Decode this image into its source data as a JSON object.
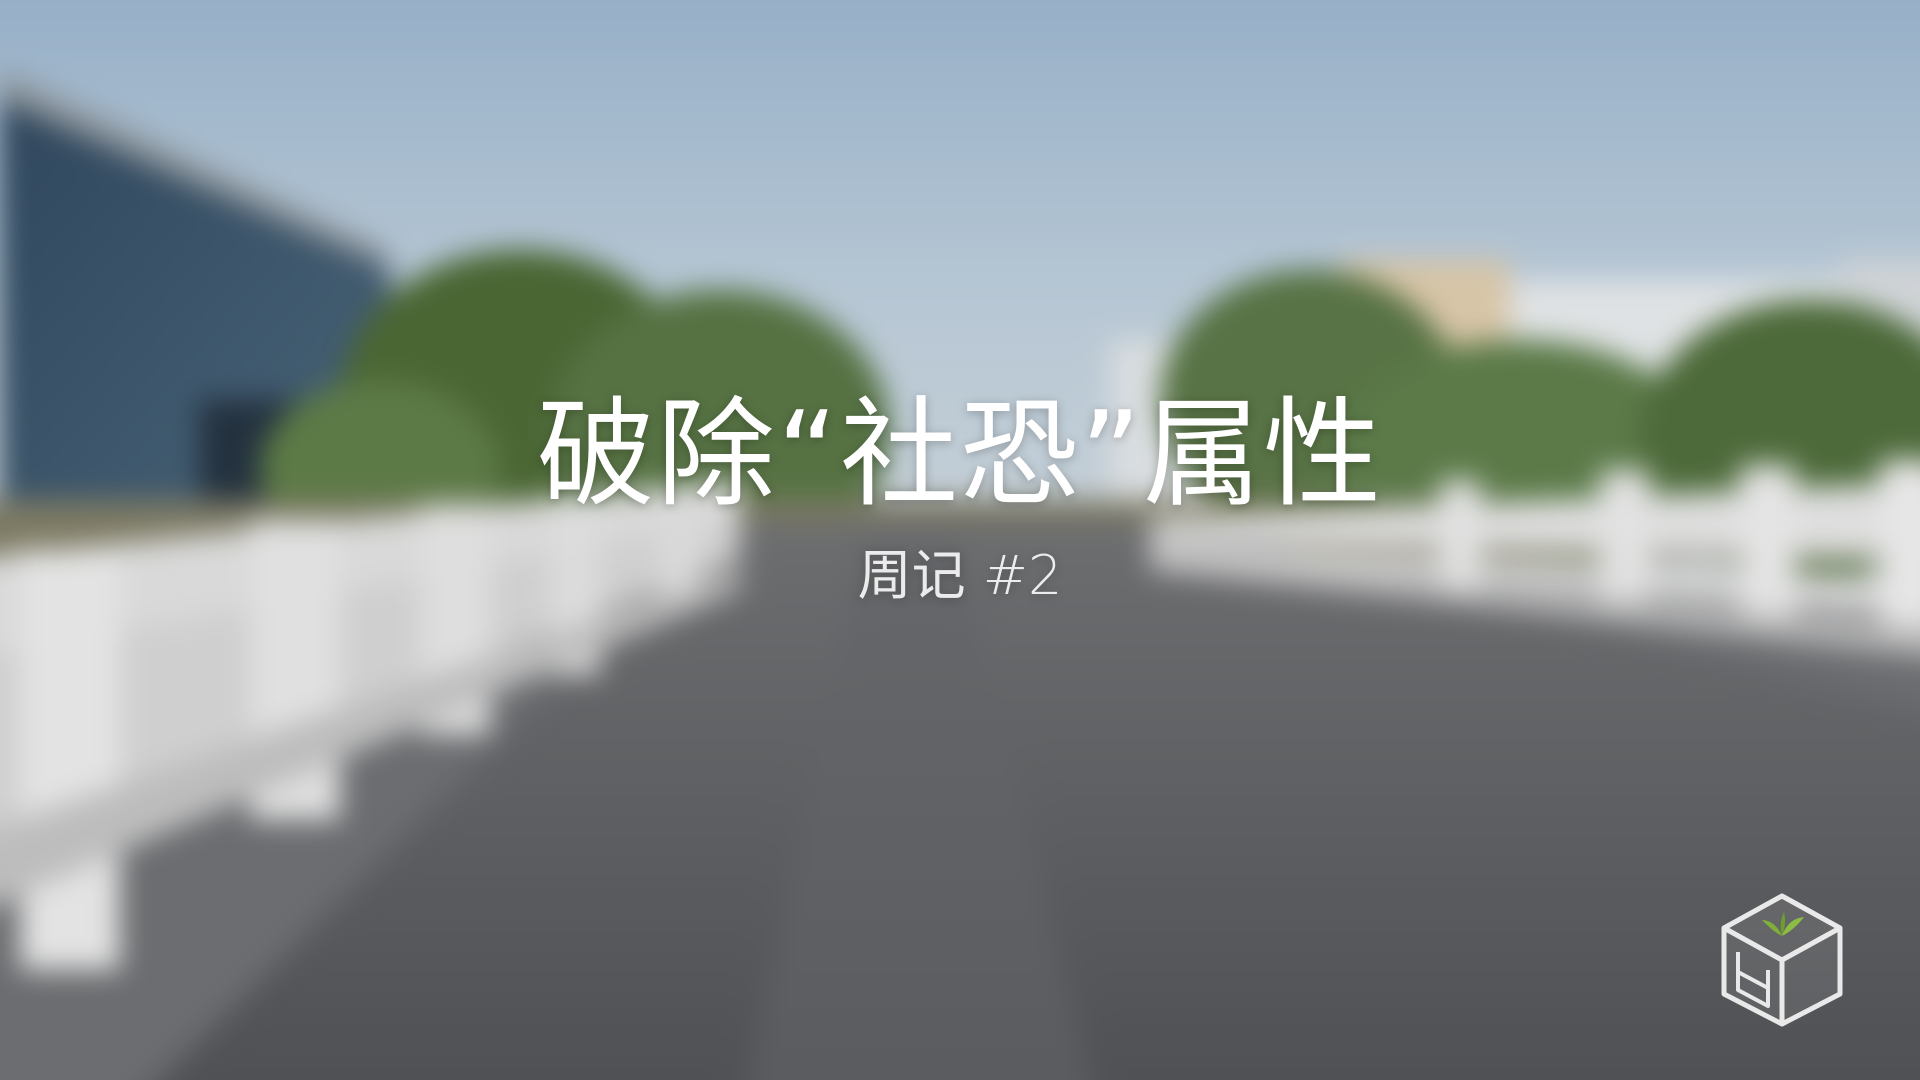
{
  "title": "破除“社恐”属性",
  "subtitle": "周记 #2",
  "logo_icon": "box-sprout-logo",
  "colors": {
    "sky_top": "#9fb6cc",
    "sky_bottom": "#c6d1da",
    "road": "#5e5f63",
    "railing": "#dcdcdc",
    "trees": "#4f6d3a",
    "building_glass": "#3a5166",
    "title_text": "#ffffff"
  }
}
